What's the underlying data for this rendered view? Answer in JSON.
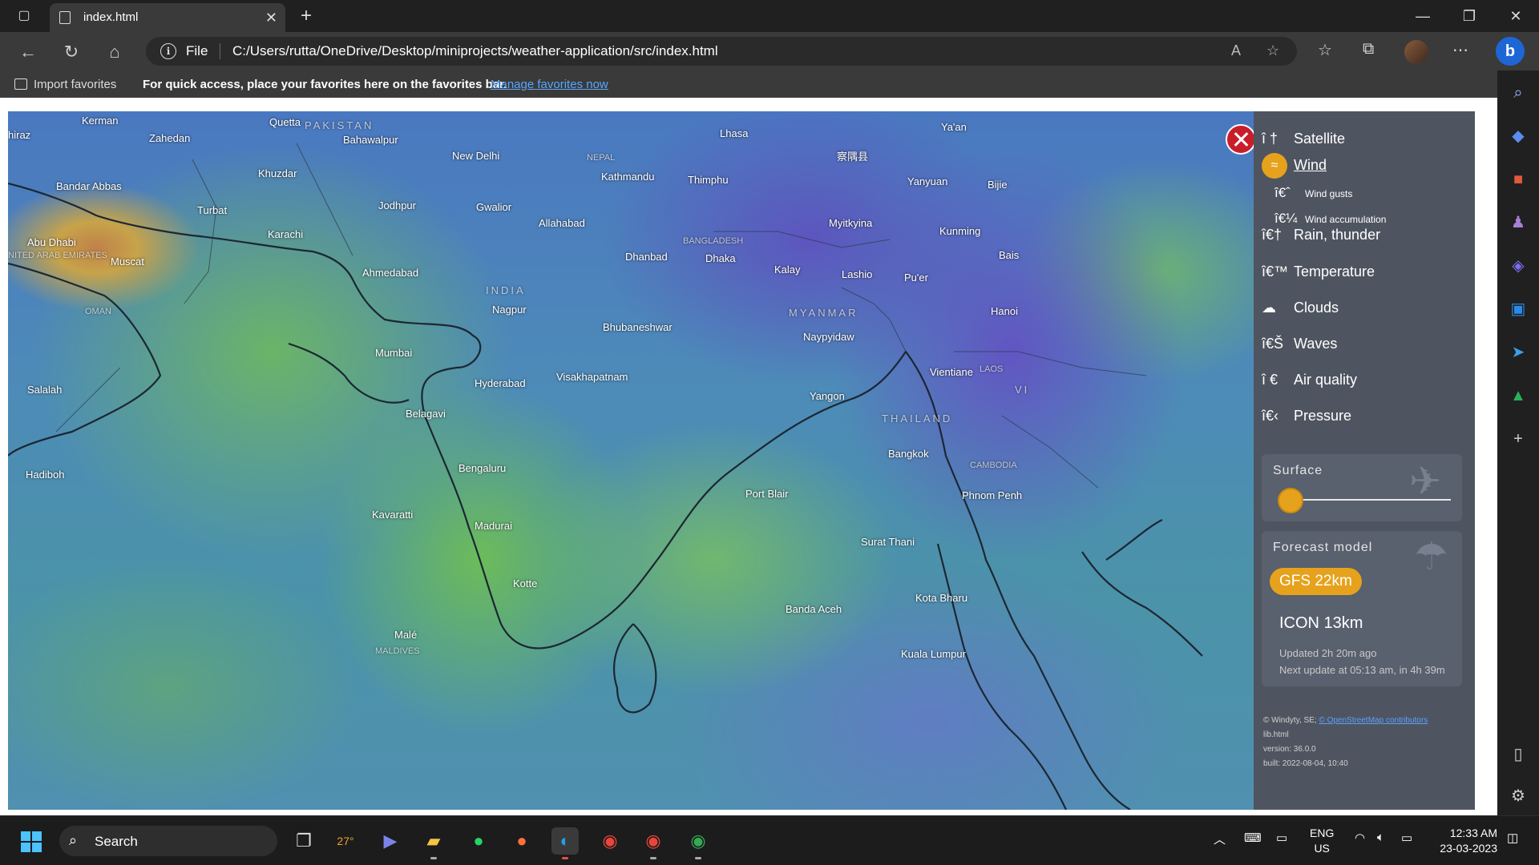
{
  "browser": {
    "tab_title": "index.html",
    "scheme_label": "File",
    "url": "C:/Users/rutta/OneDrive/Desktop/miniprojects/weather-application/src/index.html"
  },
  "favorites": {
    "import_label": "Import favorites",
    "hint_text": "For quick access, place your favorites here on the favorites bar.",
    "manage_link": "Manage favorites now"
  },
  "map": {
    "cities": [
      {
        "name": "Kerman"
      },
      {
        "name": "hiraz"
      },
      {
        "name": "Zahedan"
      },
      {
        "name": "Quetta"
      },
      {
        "name": "Bahawalpur"
      },
      {
        "name": "Bandar Abbas"
      },
      {
        "name": "Khuzdar"
      },
      {
        "name": "Turbat"
      },
      {
        "name": "Abu Dhabi"
      },
      {
        "name": "Muscat"
      },
      {
        "name": "Karachi"
      },
      {
        "name": "Jodhpur"
      },
      {
        "name": "Ahmedabad"
      },
      {
        "name": "New Delhi"
      },
      {
        "name": "Gwalior"
      },
      {
        "name": "Allahabad"
      },
      {
        "name": "Kathmandu"
      },
      {
        "name": "Lhasa"
      },
      {
        "name": "Thimphu"
      },
      {
        "name": "察隅县"
      },
      {
        "name": "Ya'an"
      },
      {
        "name": "Yanyuan"
      },
      {
        "name": "Bijie"
      },
      {
        "name": "Kunming"
      },
      {
        "name": "Myitkyina"
      },
      {
        "name": "Dhanbad"
      },
      {
        "name": "Dhaka"
      },
      {
        "name": "Kalay"
      },
      {
        "name": "Lashio"
      },
      {
        "name": "Pu'er"
      },
      {
        "name": "Bais"
      },
      {
        "name": "Nagpur"
      },
      {
        "name": "Bhubaneshwar"
      },
      {
        "name": "Naypyidaw"
      },
      {
        "name": "Hanoi"
      },
      {
        "name": "Salalah"
      },
      {
        "name": "Mumbai"
      },
      {
        "name": "Hyderabad"
      },
      {
        "name": "Visakhapatnam"
      },
      {
        "name": "Vientiane"
      },
      {
        "name": "Yangon"
      },
      {
        "name": "Belagavi"
      },
      {
        "name": "Hadiboh"
      },
      {
        "name": "Bengaluru"
      },
      {
        "name": "Bangkok"
      },
      {
        "name": "Port Blair"
      },
      {
        "name": "Phnom Penh"
      },
      {
        "name": "Kavaratti"
      },
      {
        "name": "Madurai"
      },
      {
        "name": "Surat Thani"
      },
      {
        "name": "Kotte"
      },
      {
        "name": "Kota Bharu"
      },
      {
        "name": "Banda Aceh"
      },
      {
        "name": "Malé"
      },
      {
        "name": "Kuala Lumpur"
      }
    ],
    "countries": [
      {
        "name": "PAKISTAN"
      },
      {
        "name": "NEPAL"
      },
      {
        "name": "BANGLADESH"
      },
      {
        "name": "INDIA"
      },
      {
        "name": "MYANMAR"
      },
      {
        "name": "THAILAND"
      },
      {
        "name": "LAOS"
      },
      {
        "name": "CAMBODIA"
      },
      {
        "name": "OMAN"
      },
      {
        "name": "NITED ARAB EMIRATES"
      },
      {
        "name": "MALDIVES"
      },
      {
        "name": "VI"
      }
    ]
  },
  "menu": {
    "layers": [
      {
        "glyph": "î †",
        "label": "Satellite"
      },
      {
        "glyph": "≈",
        "label": "Wind"
      },
      {
        "glyph": "î€ˆ",
        "label": "Wind gusts"
      },
      {
        "glyph": "î€¼",
        "label": "Wind accumulation"
      },
      {
        "glyph": "î€†",
        "label": "Rain, thunder"
      },
      {
        "glyph": "î€™",
        "label": "Temperature"
      },
      {
        "glyph": "☁",
        "label": "Clouds"
      },
      {
        "glyph": "î€Š",
        "label": "Waves"
      },
      {
        "glyph": "î €",
        "label": "Air quality"
      },
      {
        "glyph": "î€‹",
        "label": "Pressure"
      }
    ],
    "surface_title": "Surface",
    "forecast_title": "Forecast model",
    "model_active": "GFS 22km",
    "model_other": "ICON 13km",
    "updated": "Updated 2h 20m ago",
    "next_update": "Next update at 05:13 am, in 4h 39m",
    "credits": {
      "prefix": "© Windyty, SE;",
      "osm": "© OpenStreetMap contributors",
      "lib": "lib.html",
      "version": "version: 36.0.0",
      "built": "built: 2022-08-04, 10:40"
    }
  },
  "taskbar": {
    "search_label": "Search",
    "weather_temp": "27°",
    "lang_top": "ENG",
    "lang_bottom": "US",
    "time": "12:33 AM",
    "date": "23-03-2023"
  },
  "colors": {
    "accent": "#e6a21c",
    "close": "#c81e2a",
    "link": "#58a6ff"
  }
}
